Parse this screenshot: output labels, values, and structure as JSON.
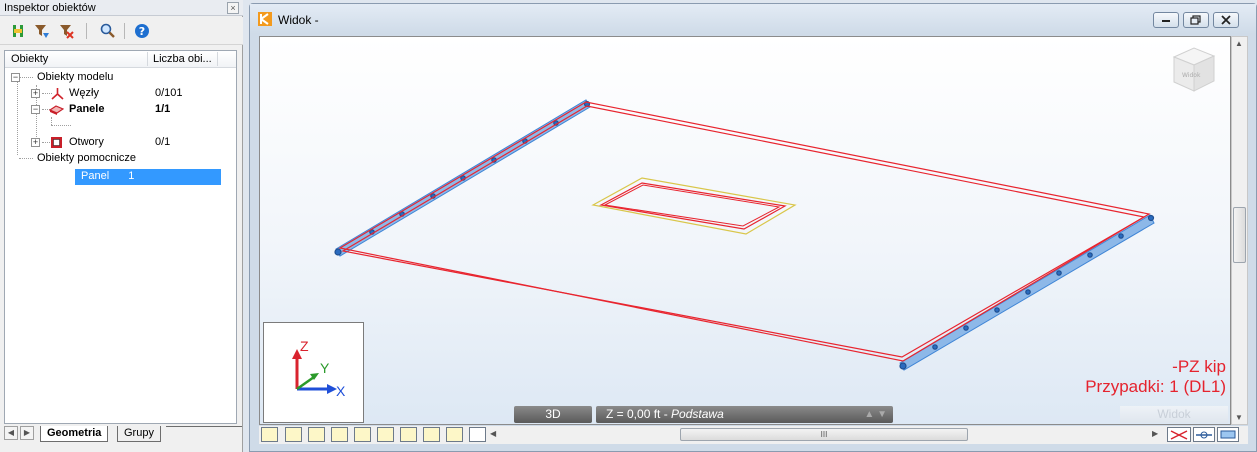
{
  "inspector": {
    "title": "Inspektor obiektów",
    "close_glyph": "×",
    "toolbar_icons": [
      "select-tree-icon",
      "filter-icon",
      "filter-clear-icon",
      "search-icon",
      "help-icon"
    ],
    "columns": {
      "objects": "Obiekty",
      "count": "Liczba obi..."
    },
    "tree": {
      "root_model": "Obiekty modelu",
      "nodes": [
        {
          "label": "Węzły",
          "count": "0/101",
          "expander": "+"
        },
        {
          "label": "Panele",
          "count": "1/1",
          "expander": "−",
          "bold": true
        },
        {
          "label": "Panel",
          "id": "1",
          "selected": true
        },
        {
          "label": "Otwory",
          "count": "0/1",
          "expander": "+"
        }
      ],
      "root_aux": "Obiekty pomocnicze"
    },
    "tabs": [
      "Geometria",
      "Grupy"
    ],
    "active_tab": "Geometria"
  },
  "view": {
    "title": "Widok -",
    "nav_cube_text": "Widok",
    "status": {
      "mode": "3D",
      "z_level": "Z = 0,00 ft",
      "z_separator": " - ",
      "story": "Podstawa",
      "right_label": "Widok"
    },
    "result": {
      "line1": "-PZ   kip",
      "line2": "Przypadki: 1 (DL1)"
    },
    "axes": {
      "x": "X",
      "y": "Y",
      "z": "Z"
    },
    "hscroll_grip": "III",
    "colors": {
      "panel_edge": "#e8252f",
      "support_blue": "#3f85d6",
      "opening_yellow": "#d9c64a",
      "axis_x": "#1f4fd8",
      "axis_y": "#2b9a2b",
      "axis_z": "#d9232e",
      "result_text": "#e5232e"
    }
  }
}
